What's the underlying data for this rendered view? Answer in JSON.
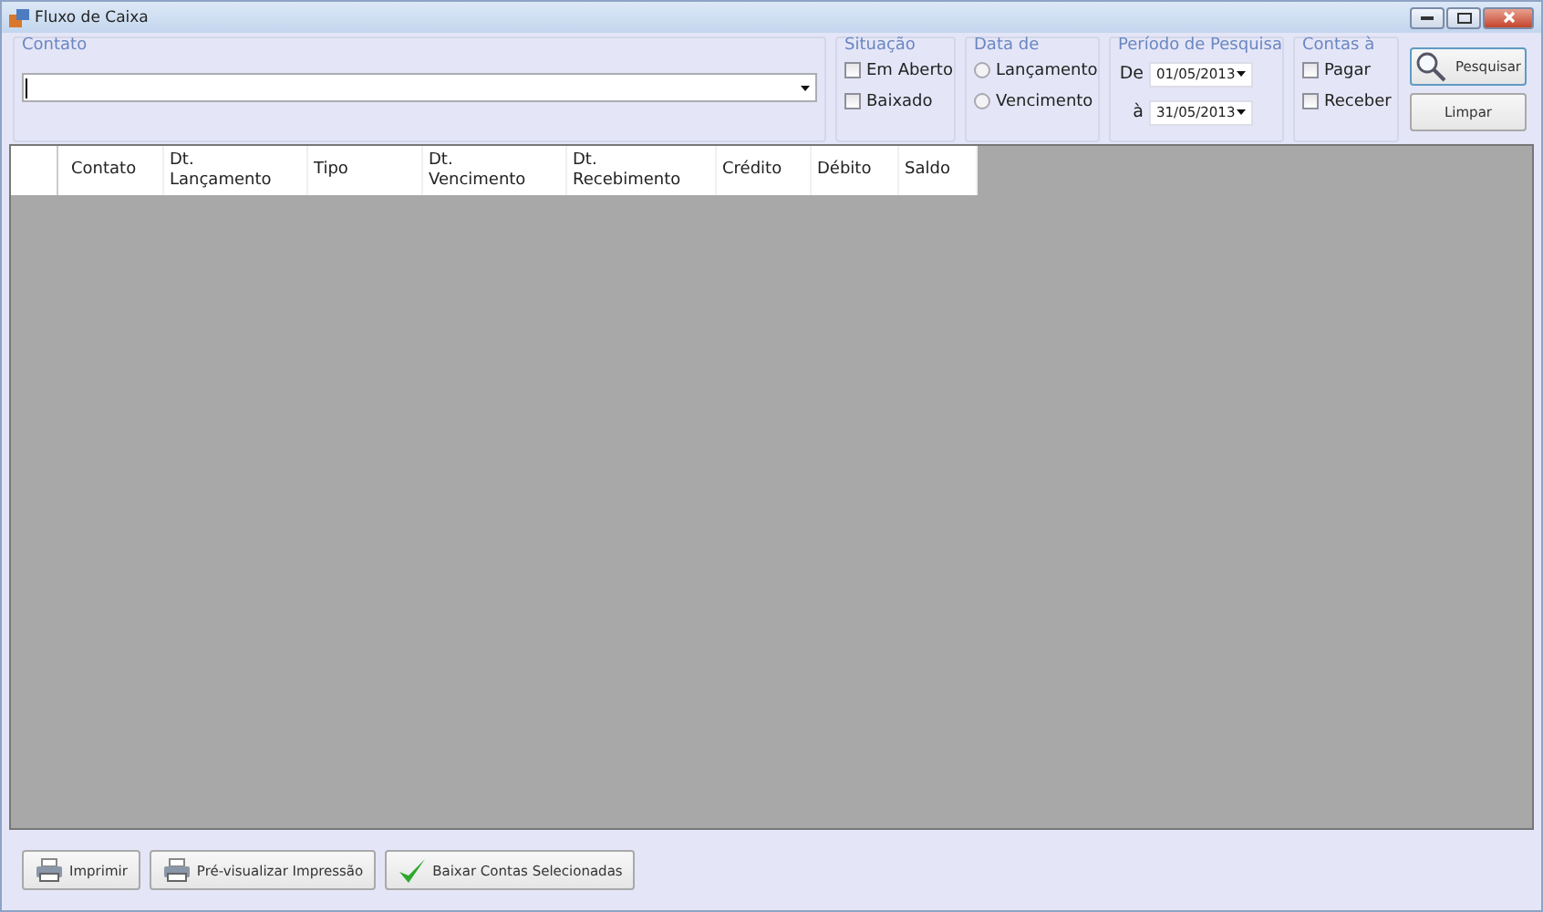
{
  "window": {
    "title": "Fluxo de Caixa"
  },
  "contato": {
    "title": "Contato"
  },
  "situacao": {
    "title": "Situação",
    "options": [
      {
        "label": "Em Aberto",
        "checked": false
      },
      {
        "label": "Baixado",
        "checked": false
      }
    ]
  },
  "data_de": {
    "title": "Data de",
    "options": [
      {
        "label": "Lançamento",
        "selected": false
      },
      {
        "label": "Vencimento",
        "selected": false
      }
    ]
  },
  "periodo": {
    "title": "Período de Pesquisa",
    "from_label": "De",
    "from": "01/05/2013",
    "to_label": "à",
    "to": "31/05/2013"
  },
  "contas": {
    "title": "Contas à",
    "options": [
      {
        "label": "Pagar",
        "checked": false
      },
      {
        "label": "Receber",
        "checked": false
      }
    ]
  },
  "actions": [
    {
      "label": "Pesquisar",
      "kind": "search"
    },
    {
      "label": "Limpar",
      "kind": "plain"
    }
  ],
  "table": {
    "columns": [
      {
        "label": "Contato"
      },
      {
        "label": "Dt.\nLançamento"
      },
      {
        "label": "Tipo"
      },
      {
        "label": "Dt.\nVencimento"
      },
      {
        "label": "Dt.\nRecebimento"
      },
      {
        "label": "Crédito"
      },
      {
        "label": "Débito"
      },
      {
        "label": "Saldo"
      }
    ]
  },
  "bottom_buttons": [
    {
      "label": "Imprimir",
      "kind": "print"
    },
    {
      "label": "Pré-visualizar Impressão",
      "kind": "print"
    },
    {
      "label": "Baixar Contas Selecionadas",
      "kind": "check"
    }
  ]
}
